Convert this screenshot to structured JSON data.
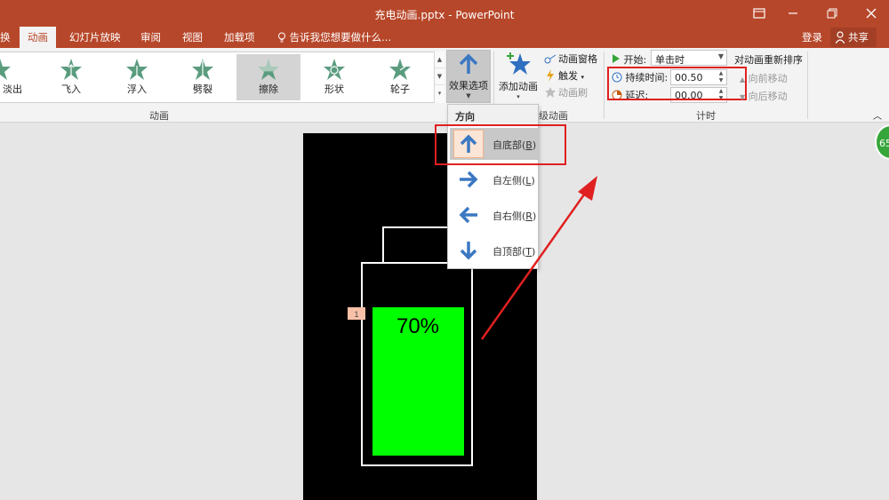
{
  "window": {
    "title": "充电动画.pptx - PowerPoint"
  },
  "tabs": [
    {
      "label": "换",
      "active": false
    },
    {
      "label": "动画",
      "active": true
    },
    {
      "label": "幻灯片放映",
      "active": false
    },
    {
      "label": "审阅",
      "active": false
    },
    {
      "label": "视图",
      "active": false
    },
    {
      "label": "加载项",
      "active": false
    }
  ],
  "tell_me": "告诉我您想要做什么...",
  "account": {
    "login": "登录",
    "share": "共享"
  },
  "animation_gallery": {
    "items": [
      "淡出",
      "飞入",
      "浮入",
      "劈裂",
      "擦除",
      "形状",
      "轮子"
    ],
    "selected": "擦除",
    "group_label": "动画"
  },
  "effect_options": {
    "label": "效果选项",
    "icon": "arrow-up-icon"
  },
  "advanced_animation": {
    "add_animation": "添加动画",
    "animation_pane": "动画窗格",
    "trigger": "触发",
    "animation_painter": "动画刷",
    "group_label": "高级动画",
    "group_label_visible": "级动画"
  },
  "timing": {
    "start_label": "开始:",
    "start_value": "单击时",
    "duration_label": "持续时间:",
    "duration_value": "00.50",
    "delay_label": "延迟:",
    "delay_value": "00.00",
    "reorder_title": "对动画重新排序",
    "move_earlier": "向前移动",
    "move_later": "向后移动",
    "group_label": "计时"
  },
  "direction_menu": {
    "header": "方向",
    "items": [
      {
        "label": "自底部",
        "key": "B",
        "icon": "arrow-up-icon",
        "selected": true
      },
      {
        "label": "自左侧",
        "key": "L",
        "icon": "arrow-right-icon",
        "selected": false
      },
      {
        "label": "自右侧",
        "key": "R",
        "icon": "arrow-left-icon",
        "selected": false
      },
      {
        "label": "自顶部",
        "key": "T",
        "icon": "arrow-down-icon",
        "selected": false
      }
    ]
  },
  "slide": {
    "battery_percent_text": "70%",
    "animation_order_tag": "1",
    "fill_level": 0.7,
    "fill_color": "#00ff00"
  },
  "floating_badge": "65",
  "colors": {
    "accent": "#b7472a",
    "annotation_red": "#e02020",
    "gallery_star": "#5b9c7f"
  }
}
